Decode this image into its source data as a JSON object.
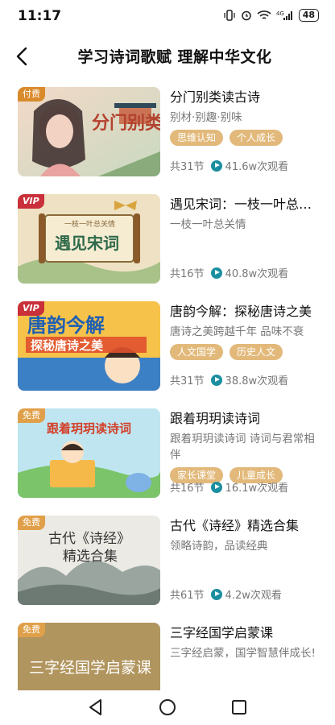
{
  "status_bar": {
    "time": "11:17",
    "battery": "48",
    "signal_label": "4G"
  },
  "header": {
    "title": "学习诗词歌赋 理解中华文化"
  },
  "colors": {
    "accent_teal": "#1b8fa0",
    "tag_bg": "#e2b97a",
    "vip_badge": "#c9303a"
  },
  "courses": [
    {
      "badge": "付费",
      "thumb_text": "分门别类读古诗",
      "title": "分门别类读古诗",
      "desc": "别材·别趣·别味",
      "tags": [
        "思维认知",
        "个人成长"
      ],
      "lessons": "共31节",
      "views": "41.6w次观看"
    },
    {
      "badge": "VIP",
      "thumb_text": "遇见宋词",
      "thumb_sub": "一枝一叶总关情",
      "title": "遇见宋词：一枝一叶总关情",
      "desc": "一枝一叶总关情",
      "tags": [],
      "lessons": "共16节",
      "views": "40.8w次观看"
    },
    {
      "badge": "VIP",
      "thumb_text": "唐韵今解",
      "thumb_sub": "探秘唐诗之美",
      "title": "唐韵今解：探秘唐诗之美",
      "desc": "唐诗之美跨越千年 品味不衰",
      "tags": [
        "人文国学",
        "历史人文"
      ],
      "lessons": "共31节",
      "views": "38.8w次观看"
    },
    {
      "badge": "免费",
      "thumb_text": "跟着玥玥读诗词",
      "title": "跟着玥玥读诗词",
      "desc": "跟着玥玥读诗词 诗词与君常相伴",
      "tags": [
        "家长课堂",
        "儿童成长"
      ],
      "lessons": "共16节",
      "views": "16.1w次观看"
    },
    {
      "badge": "免费",
      "thumb_text": "古代《诗经》",
      "thumb_sub": "精选合集",
      "title": "古代《诗经》精选合集",
      "desc": "领略诗韵，品读经典",
      "tags": [],
      "lessons": "共61节",
      "views": "4.2w次观看"
    },
    {
      "badge": "免费",
      "thumb_text": "三字经国学启蒙课",
      "title": "三字经国学启蒙课",
      "desc": "三字经启蒙，国学智慧伴成长!",
      "tags": [],
      "lessons": "",
      "views": ""
    }
  ],
  "nav": {
    "back": "back-triangle",
    "home": "home-circle",
    "recent": "recent-square"
  }
}
